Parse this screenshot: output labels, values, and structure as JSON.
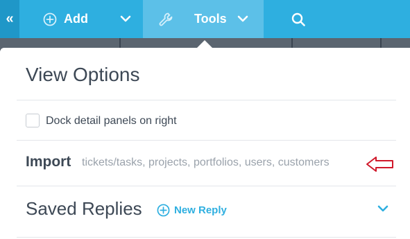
{
  "nav": {
    "add_label": "Add",
    "tools_label": "Tools",
    "collapse_glyph": "«",
    "icons": [
      "double-chevron-left-icon",
      "plus-circle-icon",
      "chevron-down-icon",
      "wrench-icon",
      "search-icon"
    ]
  },
  "menu": {
    "title": "View Options",
    "dock_option": {
      "label": "Dock detail panels on right",
      "checked": false
    },
    "import": {
      "label": "Import",
      "description": "tickets/tasks, projects, portfolios, users, customers"
    },
    "saved_replies": {
      "label": "Saved Replies",
      "new_reply_label": "New Reply"
    }
  },
  "colors": {
    "accent": "#2eafe0",
    "nav_active": "#5cc0e8",
    "text": "#3d4855",
    "muted_text": "#9aa2ab",
    "annotation_arrow": "#d0182a"
  }
}
